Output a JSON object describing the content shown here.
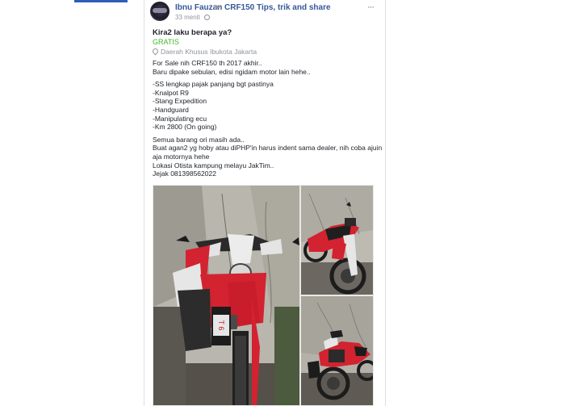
{
  "post": {
    "author": "Ibnu Fauzan",
    "group": "CRF150 Tips, trik and share",
    "time": "33 menit",
    "more_label": "···",
    "title": "Kira2 laku berapa ya?",
    "price": "GRATIS",
    "location": "Daerah Khusus Ibukota Jakarta",
    "body_lines": [
      "For Sale nih CRF150 th 2017 akhir..",
      "Baru dipake sebulan, edisi ngidam motor lain hehe..",
      "-SS lengkap pajak panjang bgt pastinya",
      "-Knalpot R9",
      "-Stang Expedition",
      "-Handguard",
      "-Manipulating ecu",
      "-Km 2800 (On going)",
      "Semua barang ori masih ada..",
      "Buat agan2 yg hoby atau diPHP'in harus indent sama dealer, nih coba ajuin",
      "aja motornya hehe",
      "Lokasi Otista kampung melayu JakTim..",
      "Jejak 081398562022"
    ],
    "plate_text": "T 6"
  },
  "colors": {
    "link": "#365899",
    "price": "#42b72a",
    "meta": "#90949c",
    "bike_red": "#d32230"
  }
}
